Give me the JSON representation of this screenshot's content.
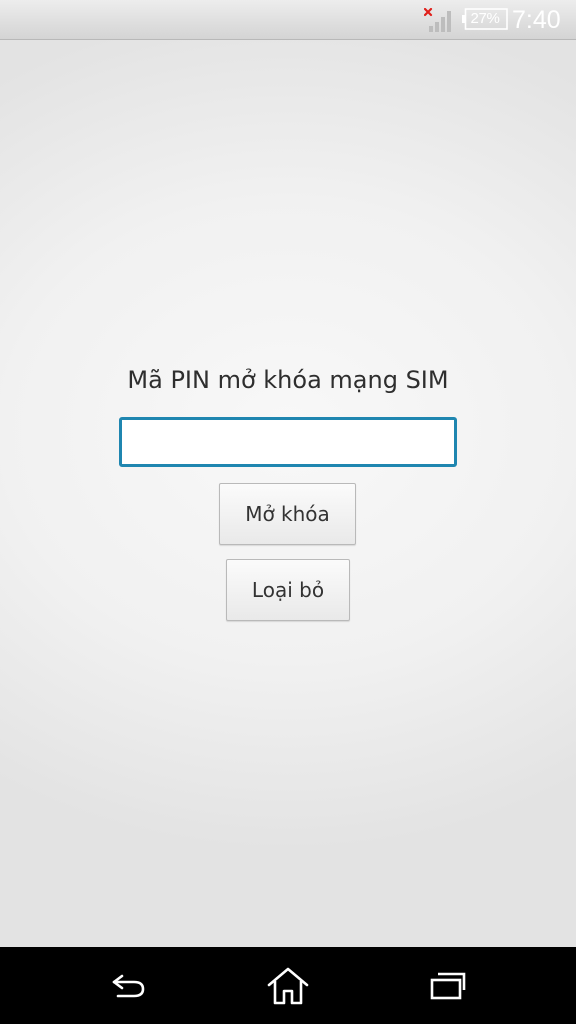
{
  "status_bar": {
    "battery_percent": "27%",
    "time": "7:40",
    "icons": [
      "signal-no-sim-icon",
      "battery-icon"
    ],
    "signal_error_color": "#e0201b"
  },
  "sim_unlock": {
    "title": "Mã PIN mở khóa mạng SIM",
    "pin_value": "",
    "unlock_label": "Mở khóa",
    "dismiss_label": "Loại bỏ",
    "accent_color": "#1f86b0"
  },
  "nav_bar": {
    "icons": [
      "back-icon",
      "home-icon",
      "recent-apps-icon"
    ]
  }
}
